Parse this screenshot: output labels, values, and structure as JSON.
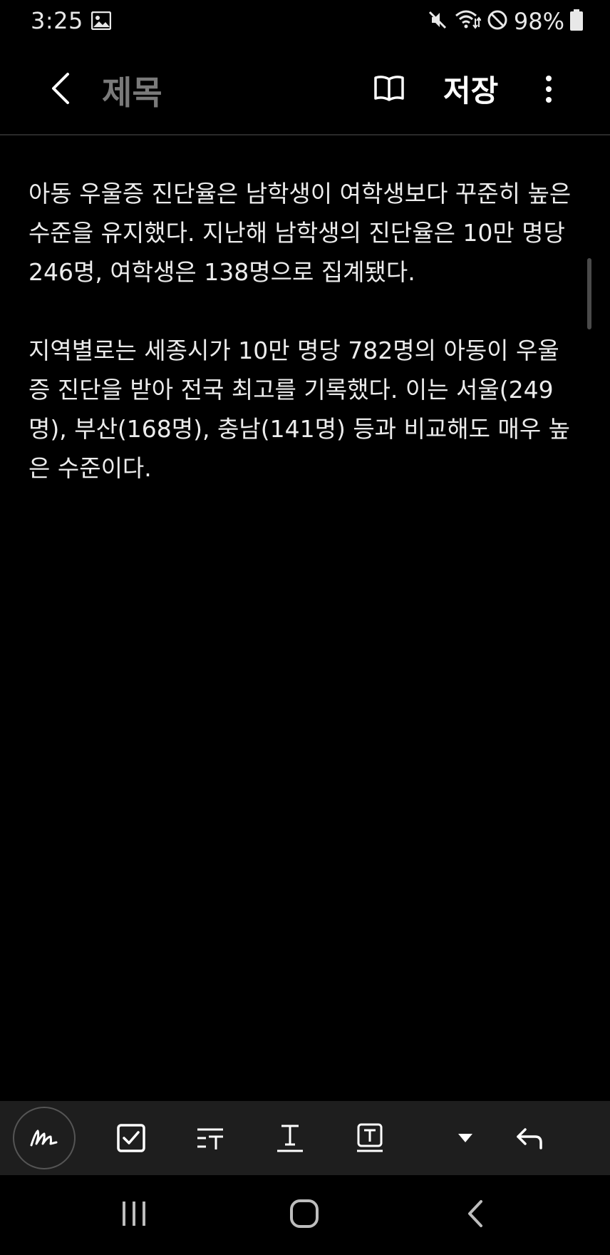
{
  "status_bar": {
    "time": "3:25",
    "battery_percent": "98%",
    "icons": [
      "gallery-icon",
      "mute-icon",
      "wifi-icon",
      "do-not-disturb-icon",
      "battery-icon"
    ]
  },
  "app_bar": {
    "title_placeholder": "제목",
    "save_label": "저장",
    "icons": [
      "back-icon",
      "reading-mode-icon",
      "more-options-icon"
    ]
  },
  "note": {
    "paragraphs": [
      "아동 우울증 진단율은 남학생이 여학생보다 꾸준히 높은 수준을 유지했다. 지난해 남학생의 진단율은 10만 명당 246명, 여학생은 138명으로 집계됐다.",
      "지역별로는 세종시가 10만 명당 782명의 아동이 우울증 진단을 받아 전국 최고를 기록했다. 이는 서울(249명), 부산(168명), 충남(141명) 등과 비교해도 매우 높은 수준이다."
    ]
  },
  "toolbar": {
    "icons": [
      "pen-icon",
      "checkbox-icon",
      "text-style-icon",
      "underline-text-icon",
      "text-box-icon",
      "dropdown-arrow-icon",
      "undo-icon"
    ]
  },
  "nav_bar": {
    "icons": [
      "recent-apps-icon",
      "home-icon",
      "back-nav-icon"
    ]
  },
  "colors": {
    "background": "#000000",
    "text": "#ececec",
    "title_placeholder": "#7a7a7a",
    "toolbar_bg": "#1e1e1e"
  }
}
